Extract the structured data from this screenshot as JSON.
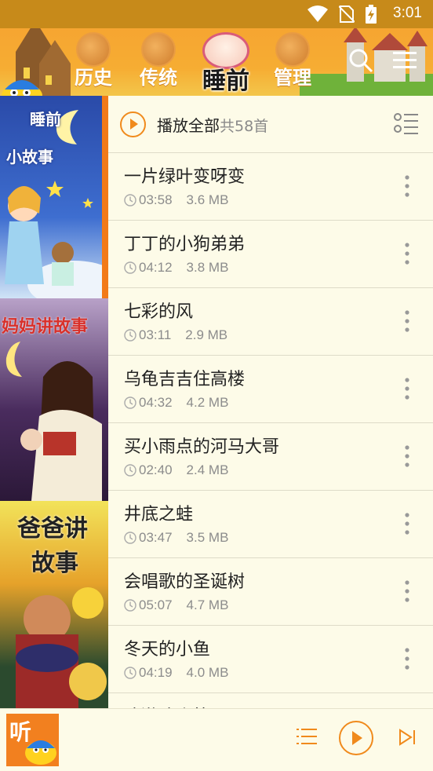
{
  "status_bar": {
    "time": "3:01"
  },
  "header": {
    "tabs": [
      {
        "label": "历史",
        "active": false
      },
      {
        "label": "传统",
        "active": false
      },
      {
        "label": "睡前",
        "active": true
      },
      {
        "label": "管理",
        "active": false
      }
    ]
  },
  "books": [
    {
      "title_line1": "睡前",
      "title_line2": "小故事",
      "selected": true
    },
    {
      "title": "妈妈讲故事",
      "selected": false
    },
    {
      "title_line1": "爸爸讲",
      "title_line2": "故事",
      "selected": false
    }
  ],
  "play_all": {
    "label": "播放全部",
    "count": "共58首"
  },
  "tracks": [
    {
      "title": "一片绿叶变呀变",
      "duration": "03:58",
      "size": "3.6 MB"
    },
    {
      "title": "丁丁的小狗弟弟",
      "duration": "04:12",
      "size": "3.8 MB"
    },
    {
      "title": "七彩的风",
      "duration": "03:11",
      "size": "2.9 MB"
    },
    {
      "title": "乌龟吉吉住高楼",
      "duration": "04:32",
      "size": "4.2 MB"
    },
    {
      "title": "买小雨点的河马大哥",
      "duration": "02:40",
      "size": "2.4 MB"
    },
    {
      "title": "井底之蛙",
      "duration": "03:47",
      "size": "3.5 MB"
    },
    {
      "title": "会唱歌的圣诞树",
      "duration": "05:07",
      "size": "4.7 MB"
    },
    {
      "title": "冬天的小鱼",
      "duration": "04:19",
      "size": "4.0 MB"
    },
    {
      "title": "冰激凌火箭",
      "duration": "",
      "size": ""
    }
  ],
  "player": {
    "art_label": "听"
  },
  "colors": {
    "accent": "#f08a1c",
    "header": "#f6a531",
    "background": "#fdfbe8"
  }
}
